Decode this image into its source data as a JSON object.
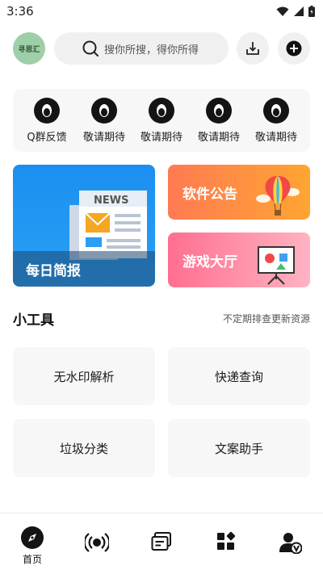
{
  "status_bar": {
    "time": "3:36"
  },
  "header": {
    "avatar_text": "寻思汇",
    "search_placeholder": "搜你所搜，得你所得"
  },
  "quick_entries": [
    {
      "label": "Q群反馈",
      "icon": "qq-penguin-icon"
    },
    {
      "label": "敬请期待",
      "icon": "qq-penguin-icon"
    },
    {
      "label": "敬请期待",
      "icon": "qq-penguin-icon"
    },
    {
      "label": "敬请期待",
      "icon": "qq-penguin-icon"
    },
    {
      "label": "敬请期待",
      "icon": "qq-penguin-icon"
    }
  ],
  "banners": {
    "daily": {
      "title": "每日简报",
      "illustration_text": "NEWS"
    },
    "notice": {
      "title": "软件公告"
    },
    "games": {
      "title": "游戏大厅"
    }
  },
  "tools_section": {
    "title": "小工具",
    "subtitle": "不定期排查更新资源",
    "items": [
      "无水印解析",
      "快递查询",
      "垃圾分类",
      "文案助手"
    ]
  },
  "bottom_nav": {
    "items": [
      {
        "label": "首页",
        "icon": "compass-icon",
        "active": true
      },
      {
        "label": "",
        "icon": "broadcast-icon"
      },
      {
        "label": "",
        "icon": "message-cards-icon"
      },
      {
        "label": "",
        "icon": "apps-grid-icon"
      },
      {
        "label": "",
        "icon": "user-vip-icon"
      }
    ]
  },
  "colors": {
    "daily_banner": "#1b8ff0",
    "notice_banner": "#ff8a45",
    "games_banner": "#ff7b98",
    "avatar_bg": "#9fcfa9"
  }
}
